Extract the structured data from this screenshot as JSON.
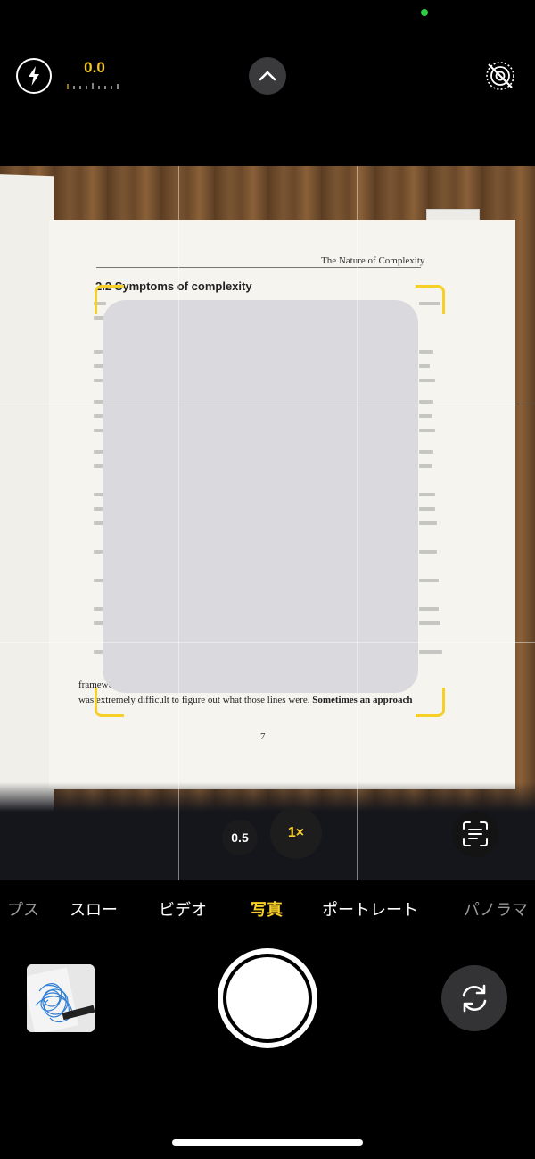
{
  "top_bar": {
    "exposure_value": "0.0",
    "flash_icon": "flash-icon",
    "chevron_icon": "chevron-up-icon",
    "live_photo_icon": "live-photo-off-icon"
  },
  "viewfinder": {
    "page_header": "The Nature of Complexity",
    "section_title": "Symptoms of complexity",
    "section_number": "2.2",
    "line_a": "frameworks that allowed appe",
    "line_b_prefix": "was extremely difficult to figure out what those lines were.",
    "line_b_bold": "Sometimes an approach",
    "page_number": "7",
    "zoom_options": [
      "0.5",
      "1×"
    ],
    "text_scan_icon": "text-scan-icon"
  },
  "modes": {
    "items": [
      "プス",
      "スロー",
      "ビデオ",
      "写真",
      "ポートレート",
      "パノラマ"
    ],
    "active": "写真"
  },
  "bottom": {
    "thumbnail_icon": "last-photo-thumbnail",
    "flip_icon": "camera-flip-icon"
  },
  "colors": {
    "accent": "#f6cf27",
    "indicator": "#2ecc40"
  }
}
